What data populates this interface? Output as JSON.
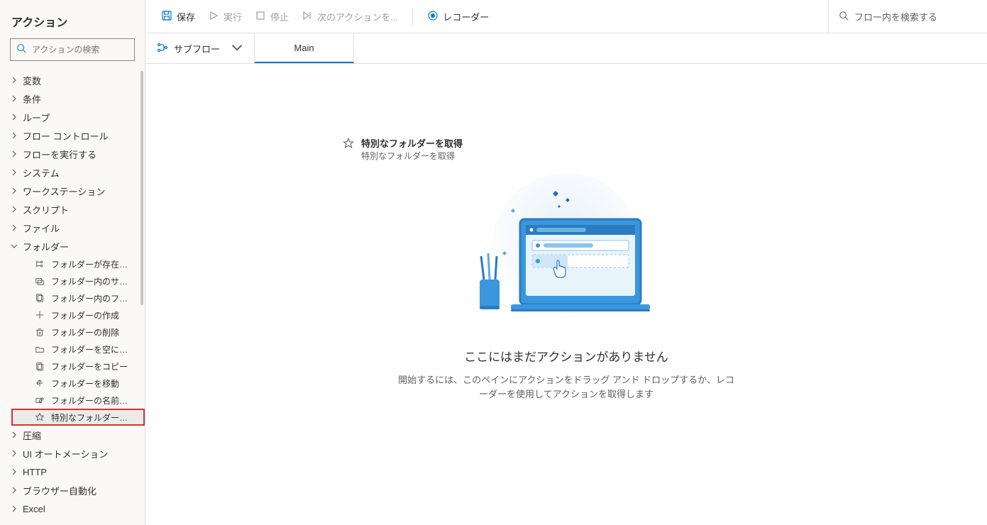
{
  "sidebar": {
    "title": "アクション",
    "search_placeholder": "アクションの検索",
    "groups": [
      {
        "label": "変数",
        "expanded": false
      },
      {
        "label": "条件",
        "expanded": false
      },
      {
        "label": "ループ",
        "expanded": false
      },
      {
        "label": "フロー コントロール",
        "expanded": false
      },
      {
        "label": "フローを実行する",
        "expanded": false
      },
      {
        "label": "システム",
        "expanded": false
      },
      {
        "label": "ワークステーション",
        "expanded": false
      },
      {
        "label": "スクリプト",
        "expanded": false
      },
      {
        "label": "ファイル",
        "expanded": false
      },
      {
        "label": "フォルダー",
        "expanded": true,
        "children": [
          {
            "icon": "branch",
            "label": "フォルダーが存在する..."
          },
          {
            "icon": "subfolder",
            "label": "フォルダー内のサブフ..."
          },
          {
            "icon": "files",
            "label": "フォルダー内のファイ..."
          },
          {
            "icon": "plus",
            "label": "フォルダーの作成"
          },
          {
            "icon": "trash",
            "label": "フォルダーの削除"
          },
          {
            "icon": "empty-folder",
            "label": "フォルダーを空にする"
          },
          {
            "icon": "copy",
            "label": "フォルダーをコピー"
          },
          {
            "icon": "move",
            "label": "フォルダーを移動"
          },
          {
            "icon": "rename",
            "label": "フォルダーの名前を変..."
          },
          {
            "icon": "star",
            "label": "特別なフォルダーを取...",
            "highlighted": true
          }
        ]
      },
      {
        "label": "圧縮",
        "expanded": false
      },
      {
        "label": "UI オートメーション",
        "expanded": false
      },
      {
        "label": "HTTP",
        "expanded": false
      },
      {
        "label": "ブラウザー自動化",
        "expanded": false
      },
      {
        "label": "Excel",
        "expanded": false
      }
    ]
  },
  "toolbar": {
    "save": "保存",
    "run": "実行",
    "stop": "停止",
    "next": "次のアクションを...",
    "recorder": "レコーダー",
    "flow_search_placeholder": "フロー内を検索する"
  },
  "tabs": {
    "subflow_label": "サブフロー",
    "main_tab": "Main"
  },
  "drag_action": {
    "title": "特別なフォルダーを取得",
    "subtitle": "特別なフォルダーを取得"
  },
  "empty": {
    "title": "ここにはまだアクションがありません",
    "sub": "開始するには、このペインにアクションをドラッグ アンド ドロップするか、レコーダーを使用してアクションを取得します"
  }
}
